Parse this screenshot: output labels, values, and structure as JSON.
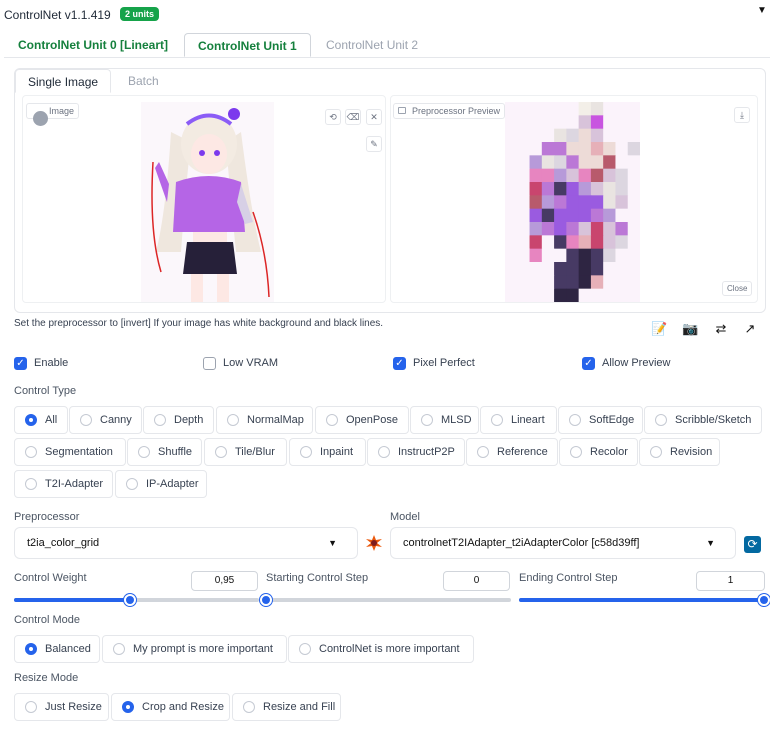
{
  "header": {
    "title": "ControlNet v1.1.419",
    "units_badge": "2 units"
  },
  "unit_tabs": [
    {
      "label": "ControlNet Unit 0 [Lineart]"
    },
    {
      "label": "ControlNet Unit 1"
    },
    {
      "label": "ControlNet Unit 2"
    }
  ],
  "image_tabs": [
    {
      "label": "Single Image"
    },
    {
      "label": "Batch"
    }
  ],
  "image_panel": {
    "image_label": "Image",
    "preview_label": "Preprocessor Preview",
    "close_label": "Close"
  },
  "hint": "Set the preprocessor to [invert] If your image has white background and black lines.",
  "checkboxes": [
    {
      "label": "Enable",
      "checked": true
    },
    {
      "label": "Low VRAM",
      "checked": false
    },
    {
      "label": "Pixel Perfect",
      "checked": true
    },
    {
      "label": "Allow Preview",
      "checked": true
    }
  ],
  "control_type": {
    "label": "Control Type",
    "options": [
      "All",
      "Canny",
      "Depth",
      "NormalMap",
      "OpenPose",
      "MLSD",
      "Lineart",
      "SoftEdge",
      "Scribble/Sketch",
      "Segmentation",
      "Shuffle",
      "Tile/Blur",
      "Inpaint",
      "InstructP2P",
      "Reference",
      "Recolor",
      "Revision",
      "T2I-Adapter",
      "IP-Adapter"
    ],
    "selected": "All"
  },
  "preprocessor": {
    "label": "Preprocessor",
    "value": "t2ia_color_grid"
  },
  "model": {
    "label": "Model",
    "value": "controlnetT2IAdapter_t2iAdapterColor [c58d39ff]"
  },
  "sliders": [
    {
      "label": "Control Weight",
      "value": "0,95",
      "fraction": 0.475
    },
    {
      "label": "Starting Control Step",
      "value": "0",
      "fraction": 0.0
    },
    {
      "label": "Ending Control Step",
      "value": "1",
      "fraction": 1.0
    }
  ],
  "control_mode": {
    "label": "Control Mode",
    "options": [
      "Balanced",
      "My prompt is more important",
      "ControlNet is more important"
    ],
    "selected": "Balanced"
  },
  "resize_mode": {
    "label": "Resize Mode",
    "options": [
      "Just Resize",
      "Crop and Resize",
      "Resize and Fill"
    ],
    "selected": "Crop and Resize"
  },
  "colors": {
    "accent": "#2563eb",
    "tab_green": "#15803d",
    "badge_green": "#16a34a"
  }
}
